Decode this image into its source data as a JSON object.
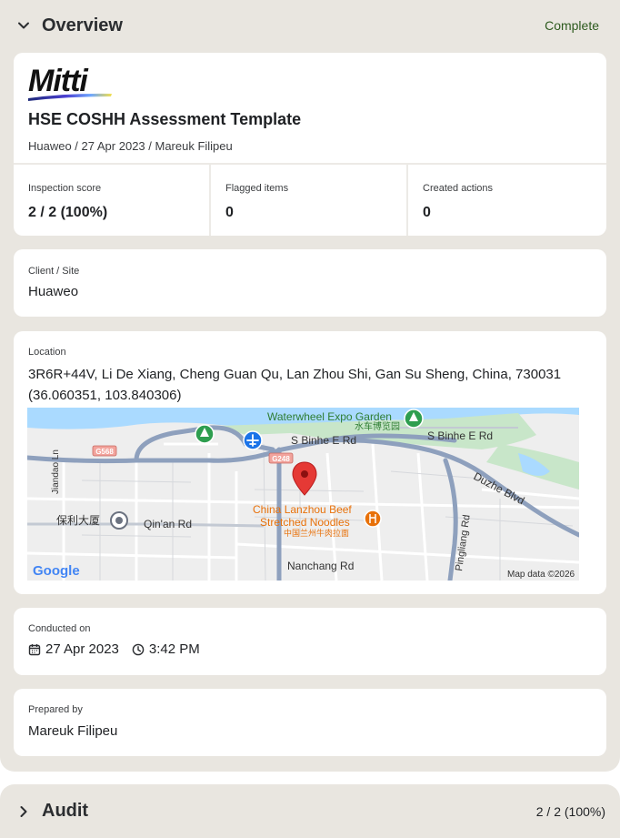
{
  "overview": {
    "title": "Overview",
    "status": "Complete",
    "header": {
      "logo_text": "Mitti",
      "title": "HSE COSHH Assessment Template",
      "subtitle": "Huaweo / 27 Apr 2023 / Mareuk Filipeu"
    },
    "stats": [
      {
        "label": "Inspection score",
        "value": "2 / 2 (100%)"
      },
      {
        "label": "Flagged items",
        "value": "0"
      },
      {
        "label": "Created actions",
        "value": "0"
      }
    ],
    "client": {
      "label": "Client / Site",
      "value": "Huaweo"
    },
    "location": {
      "label": "Location",
      "address": "3R6R+44V, Li De Xiang, Cheng Guan Qu, Lan Zhou Shi, Gan Su Sheng, China, 730031",
      "coords": "(36.060351, 103.840306)",
      "map": {
        "labels": {
          "park": "Waterwheel Expo Garden",
          "park_cn": "水车博览园",
          "road_binhe": "S Binhe E Rd",
          "road_binhe2": "S Binhe E Rd",
          "road_duzhe": "Duzhe Blvd",
          "road_jiandao": "Jiandao Ln",
          "road_qinan": "Qin'an Rd",
          "road_nanchang": "Nanchang Rd",
          "road_pingliang": "Pingliang Rd",
          "shield_g568": "G568",
          "shield_g248": "G248",
          "poi_line1": "China Lanzhou Beef",
          "poi_line2": "Stretched Noodles",
          "poi_cn": "中国兰州牛肉拉面",
          "baoli": "保利大厦",
          "google": "Google",
          "attribution": "Map data ©2026"
        },
        "colors": {
          "water": "#aadaff",
          "park": "#c8e6c9",
          "road_major": "#8ea0bd",
          "pin": "#e53935",
          "poi": "#e8710a"
        }
      }
    },
    "conducted": {
      "label": "Conducted on",
      "date": "27 Apr 2023",
      "time": "3:42 PM"
    },
    "prepared": {
      "label": "Prepared by",
      "value": "Mareuk Filipeu"
    }
  },
  "audit": {
    "title": "Audit",
    "score": "2 / 2 (100%)"
  },
  "icons": {
    "overview_chevron": "chevron-down-icon",
    "audit_chevron": "chevron-right-icon",
    "date": "calendar-icon",
    "time": "clock-icon"
  }
}
